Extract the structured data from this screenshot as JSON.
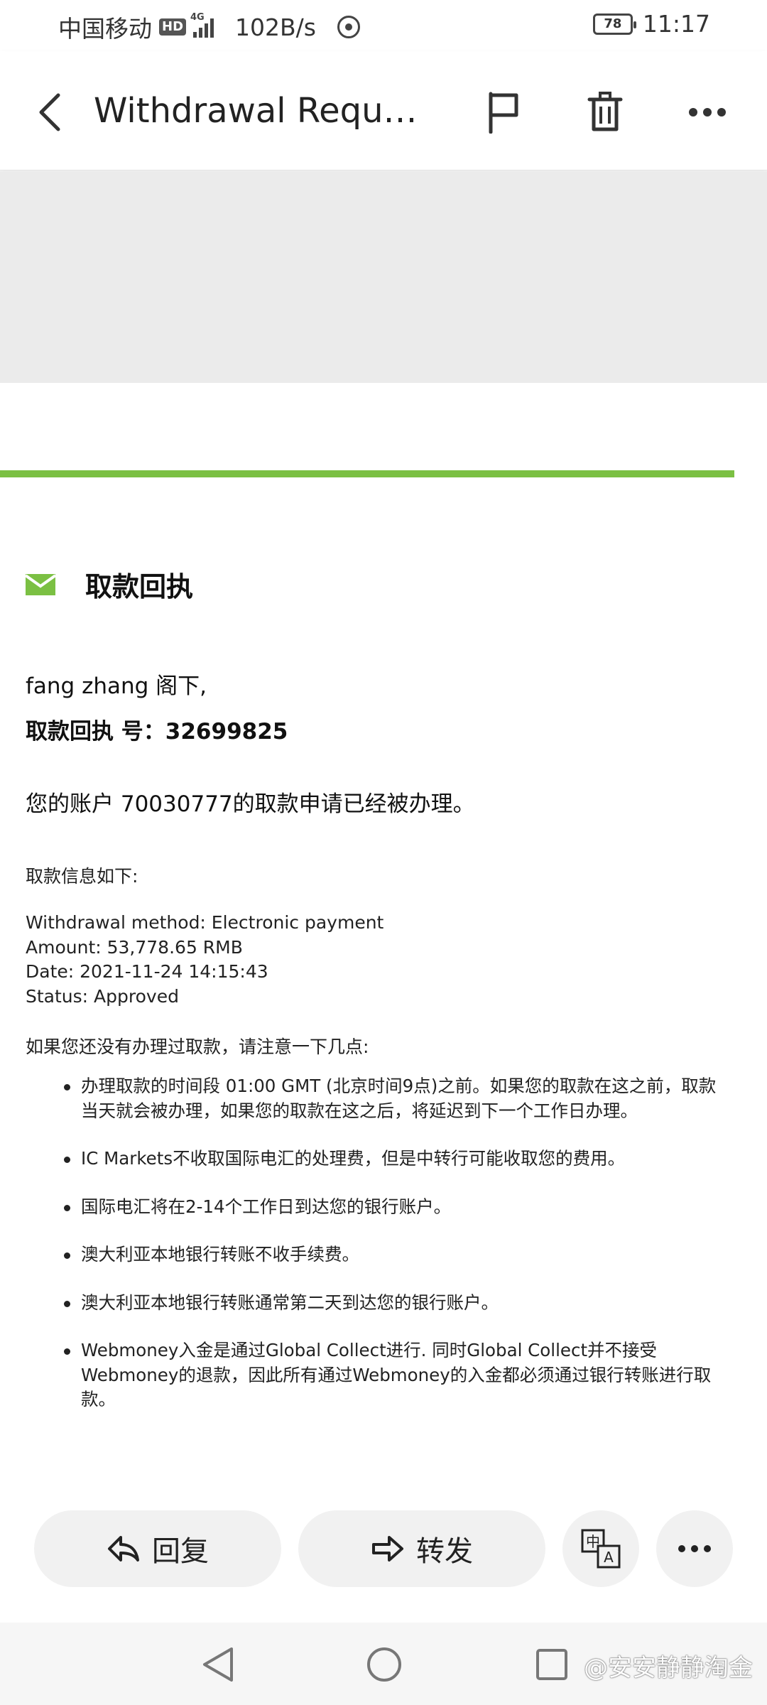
{
  "status_bar": {
    "carrier": "中国移动",
    "hd": "HD",
    "network": "4G",
    "speed": "102B/s",
    "battery": "78",
    "time": "11:17"
  },
  "app_bar": {
    "title": "Withdrawal Reques..."
  },
  "email": {
    "heading": "取款回执",
    "greeting": "fang zhang 阁下,",
    "receipt_number_line": "取款回执 号：32699825",
    "account_line": "您的账户 70030777的取款申请已经被办理。",
    "info_title": "取款信息如下:",
    "info": {
      "method": "Withdrawal method: Electronic payment",
      "amount": "Amount: 53,778.65 RMB",
      "date": "Date: 2021-11-24 14:15:43",
      "status": "Status: Approved"
    },
    "notice_title": "如果您还没有办理过取款，请注意一下几点:",
    "bullets": [
      "办理取款的时间段 01:00 GMT (北京时间9点)之前。如果您的取款在这之前，取款当天就会被办理，如果您的取款在这之后，将延迟到下一个工作日办理。",
      "IC Markets不收取国际电汇的处理费，但是中转行可能收取您的费用。",
      "国际电汇将在2-14个工作日到达您的银行账户。",
      "澳大利亚本地银行转账不收手续费。",
      "澳大利亚本地银行转账通常第二天到达您的银行账户。",
      "Webmoney入金是通过Global Collect进行. 同时Global Collect并不接受Webmoney的退款，因此所有通过Webmoney的入金都必须通过银行转账进行取款。"
    ]
  },
  "actions": {
    "reply": "回复",
    "forward": "转发"
  },
  "watermark": "@安安静静淘金",
  "colors": {
    "accent_green": "#7bc043",
    "banner_gray": "#ebebeb",
    "button_bg": "#f1f1f1"
  }
}
